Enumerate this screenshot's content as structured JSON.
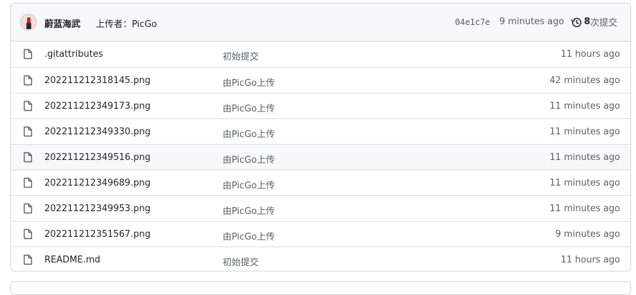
{
  "latest_commit": {
    "author": "蔚蓝海武",
    "message": "上传者：PicGo",
    "sha": "04e1c7e",
    "time": "9 minutes ago",
    "history_count": "8",
    "history_label": "次提交"
  },
  "files": [
    {
      "name": ".gitattributes",
      "message": "初始提交",
      "time": "11 hours ago",
      "icon": "file-icon"
    },
    {
      "name": "202211212318145.png",
      "message": "由PicGo上传",
      "time": "42 minutes ago",
      "icon": "file-icon"
    },
    {
      "name": "202211212349173.png",
      "message": "由PicGo上传",
      "time": "11 minutes ago",
      "icon": "file-icon"
    },
    {
      "name": "202211212349330.png",
      "message": "由PicGo上传",
      "time": "11 minutes ago",
      "icon": "file-icon"
    },
    {
      "name": "202211212349516.png",
      "message": "由PicGo上传",
      "time": "11 minutes ago",
      "icon": "file-icon"
    },
    {
      "name": "202211212349689.png",
      "message": "由PicGo上传",
      "time": "11 minutes ago",
      "icon": "file-icon"
    },
    {
      "name": "202211212349953.png",
      "message": "由PicGo上传",
      "time": "11 minutes ago",
      "icon": "file-icon"
    },
    {
      "name": "202211212351567.png",
      "message": "由PicGo上传",
      "time": "9 minutes ago",
      "icon": "file-icon"
    },
    {
      "name": "README.md",
      "message": "初始提交",
      "time": "11 hours ago",
      "icon": "file-icon"
    }
  ],
  "colors": {
    "border": "#d0d7de",
    "header_bg": "#f6f8fa",
    "muted_text": "#57606a",
    "text": "#1f2328"
  }
}
